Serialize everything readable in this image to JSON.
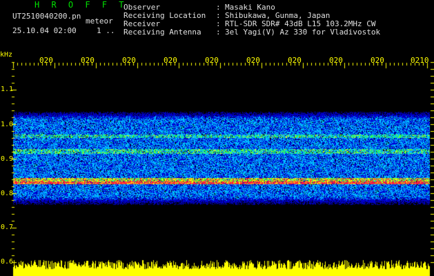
{
  "header": {
    "brand": "H R O F F T",
    "filename": "UT2510040200.pn",
    "filename_suffix": "meteor",
    "timestamp": "25.10.04 02:00",
    "timestamp_extra": "1 ..",
    "meta": [
      {
        "label": "Observer",
        "value": "Masaki Kano"
      },
      {
        "label": "Receiving Location",
        "value": "Shibukawa, Gunma, Japan"
      },
      {
        "label": "Receiver",
        "value": "RTL-SDR SDR# 43dB L15 103.2MHz CW"
      },
      {
        "label": "Receiving Antenna",
        "value": "3el Yagi(V) Az 330 for Vladivostok"
      }
    ]
  },
  "axis": {
    "y_unit": "kHz",
    "y_ticks": [
      "1.1",
      "1.0",
      "0.9",
      "0.8",
      "0.7",
      "0.6"
    ],
    "x_ticks": [
      "020",
      "020",
      "020",
      "020",
      "020",
      "020",
      "020",
      "020",
      "020",
      "0210"
    ]
  },
  "colors": {
    "axis_text": "#ffff00",
    "header_text": "#e0e0e0",
    "brand": "#00e000",
    "background": "#000000"
  }
}
